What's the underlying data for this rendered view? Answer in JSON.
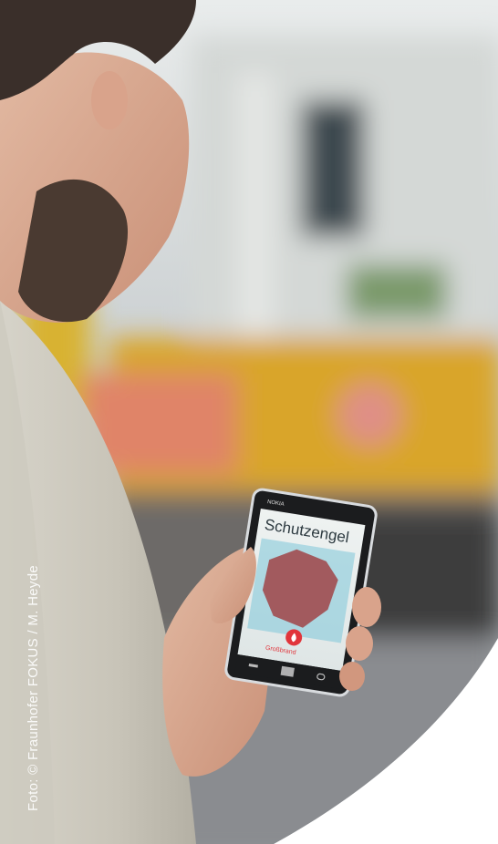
{
  "photo": {
    "credit": "Foto: © Fraunhofer FOKUS / M. Heyde"
  },
  "phone": {
    "brand": "NOKIA",
    "app_title": "Schutzengel",
    "app_subtitle": "",
    "label_top": "",
    "label_bottom": "Großbrand"
  },
  "colors": {
    "map_area": "#a25a5e",
    "map_bg": "#7ec6d8",
    "alert": "#e1353b",
    "bus_yellow": "#d9a52b"
  }
}
